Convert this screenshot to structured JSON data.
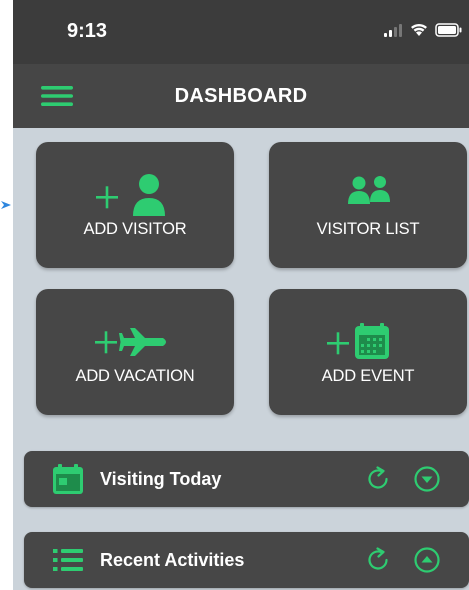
{
  "status_bar": {
    "time": "9:13",
    "icons": [
      "signal-icon",
      "wifi-icon",
      "battery-icon"
    ]
  },
  "header": {
    "title": "DASHBOARD",
    "menu_icon": "hamburger-menu-icon"
  },
  "tiles": [
    {
      "label": "ADD VISITOR",
      "icon": "add-person-icon"
    },
    {
      "label": "VISITOR LIST",
      "icon": "people-icon"
    },
    {
      "label": "ADD VACATION",
      "icon": "add-plane-icon"
    },
    {
      "label": "ADD EVENT",
      "icon": "add-calendar-icon"
    }
  ],
  "panels": [
    {
      "title": "Visiting Today",
      "icon": "calendar-icon",
      "toggle": "expand"
    },
    {
      "title": "Recent Activities",
      "icon": "list-icon",
      "toggle": "collapse"
    }
  ],
  "colors": {
    "accent": "#2ecc71",
    "header_bg": "#464646",
    "status_bg": "#3c3c3c",
    "tile_bg": "#474747",
    "page_bg": "#cbd3da",
    "pointer": "#2e86de"
  }
}
